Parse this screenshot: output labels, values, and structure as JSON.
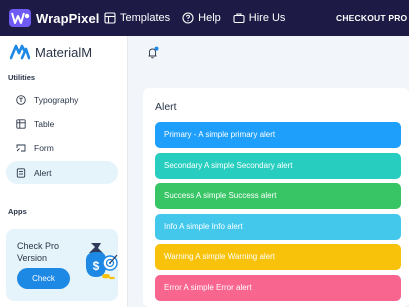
{
  "topbar": {
    "brand": "WrapPixel",
    "nav": [
      {
        "label": "Templates",
        "icon": "layout-icon"
      },
      {
        "label": "Help",
        "icon": "help-circle-icon"
      },
      {
        "label": "Hire Us",
        "icon": "briefcase-icon"
      }
    ],
    "cta": "CHECKOUT PRO VER"
  },
  "sidebar": {
    "logo": "MaterialM",
    "sections": [
      {
        "label": "Utilities"
      },
      {
        "label": "Apps"
      }
    ],
    "items": [
      {
        "label": "Typography",
        "icon": "typography-icon",
        "active": false
      },
      {
        "label": "Table",
        "icon": "table-icon",
        "active": false
      },
      {
        "label": "Form",
        "icon": "form-icon",
        "active": false
      },
      {
        "label": "Alert",
        "icon": "alert-icon",
        "active": true
      }
    ],
    "pro_card": {
      "title": "Check Pro Version",
      "button": "Check"
    }
  },
  "main": {
    "card_title": "Alert",
    "alerts": [
      {
        "text": "Primary - A simple primary alert",
        "color": "#1e9ffb"
      },
      {
        "text": "Secondary A simple Secondary alert",
        "color": "#27cec0"
      },
      {
        "text": "Success A simple Success alert",
        "color": "#38c565"
      },
      {
        "text": "Info A simple Info alert",
        "color": "#43c8ec"
      },
      {
        "text": "Warning A simple Warning alert",
        "color": "#f8c20a"
      },
      {
        "text": "Error A simple Error alert",
        "color": "#f8658f"
      }
    ]
  },
  "colors": {
    "topbar_bg": "#1d1b45",
    "accent": "#1e88e5",
    "active_bg": "#e5f3fb",
    "page_bg": "#f2f5f9"
  }
}
